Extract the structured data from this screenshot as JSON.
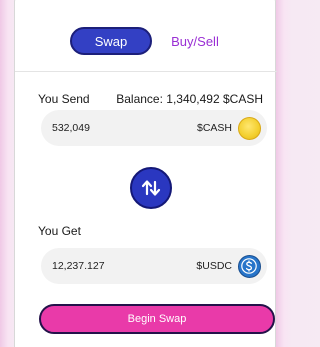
{
  "tabs": {
    "swap_label": "Swap",
    "buysell_label": "Buy/Sell"
  },
  "send": {
    "label": "You Send",
    "balance_text": "Balance: 1,340,492 $CASH",
    "amount": "532,049",
    "currency": "$CASH",
    "coin_icon": "cash-coin-icon"
  },
  "swap_toggle": {
    "icon": "swap-arrows-icon"
  },
  "get": {
    "label": "You Get",
    "amount": "12,237.127",
    "currency": "$USDC",
    "coin_icon": "usdc-coin-icon"
  },
  "action": {
    "begin_label": "Begin Swap"
  },
  "colors": {
    "primary_blue": "#3340c4",
    "accent_purple": "#9a2fd4",
    "action_pink": "#e93aa9",
    "usdc_blue": "#2775ca",
    "cash_gold": "#f3cf2e"
  }
}
